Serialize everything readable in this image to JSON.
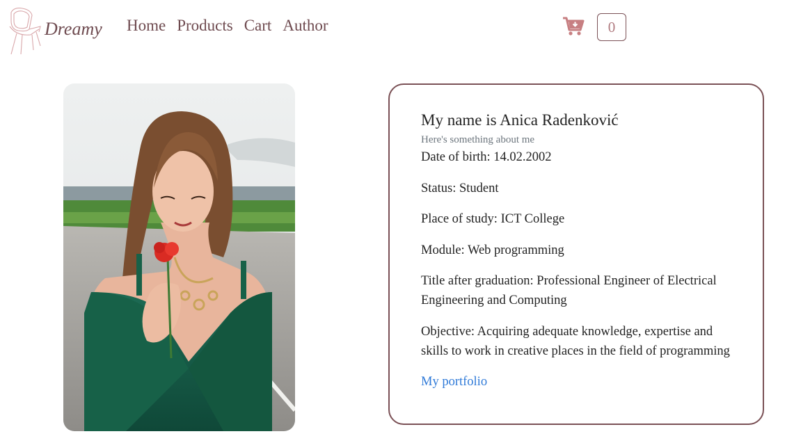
{
  "header": {
    "logo_text": "Dreamy",
    "logo_icon": "chair-icon",
    "nav": [
      {
        "label": "Home"
      },
      {
        "label": "Products"
      },
      {
        "label": "Cart"
      },
      {
        "label": "Author"
      }
    ],
    "cart_icon": "cart-download-icon",
    "cart_count": "0"
  },
  "photo": {
    "alt": "Author portrait"
  },
  "about": {
    "heading": "My name is Anica Radenković",
    "subheading": "Here's something about me",
    "rows": [
      "Date of birth: 14.02.2002",
      "Status: Student",
      "Place of study: ICT College",
      "Module: Web programming",
      "Title after graduation: Professional Engineer of Electrical Engineering and Computing",
      "Objective: Acquiring adequate knowledge, expertise and skills to work in creative places in the field of programming"
    ],
    "portfolio_link": "My portfolio"
  },
  "colors": {
    "brand": "#6e4a4f",
    "cart_icon": "#c77f82",
    "card_border": "#7a5055",
    "link": "#2f7ad8"
  }
}
